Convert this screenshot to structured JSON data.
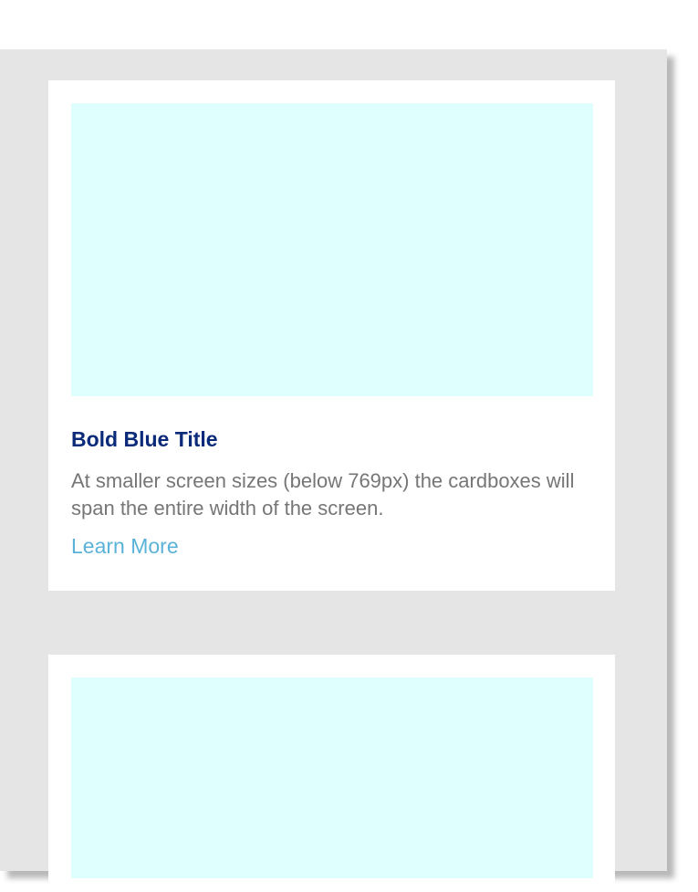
{
  "cards": [
    {
      "title": "Bold Blue Title",
      "text": "At smaller screen sizes (below 769px) the cardboxes will span the entire width of the screen.",
      "link_label": "Learn More"
    }
  ],
  "colors": {
    "panel_background": "#e5e5e5",
    "card_background": "#ffffff",
    "image_placeholder": "#dfffff",
    "title": "#0b2a7a",
    "body_text": "#767676",
    "link": "#5ab2d8"
  }
}
